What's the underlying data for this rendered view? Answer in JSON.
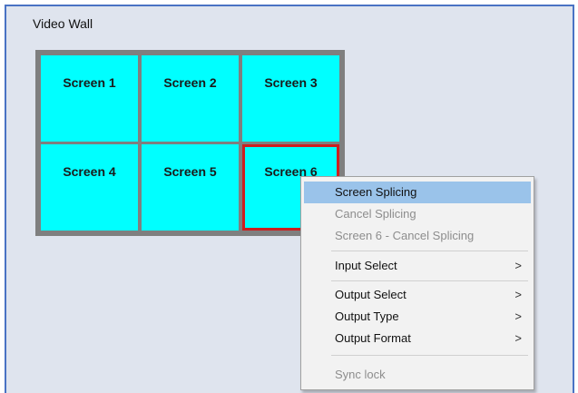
{
  "panel": {
    "title": "Video Wall"
  },
  "screens": [
    {
      "label": "Screen 1",
      "selected": false
    },
    {
      "label": "Screen 2",
      "selected": false
    },
    {
      "label": "Screen 3",
      "selected": false
    },
    {
      "label": "Screen 4",
      "selected": false
    },
    {
      "label": "Screen 5",
      "selected": false
    },
    {
      "label": "Screen 6",
      "selected": true
    }
  ],
  "context_menu": {
    "items": [
      {
        "label": "Screen Splicing",
        "enabled": true,
        "highlighted": true,
        "submenu": false
      },
      {
        "label": "Cancel Splicing",
        "enabled": false,
        "highlighted": false,
        "submenu": false
      },
      {
        "label": "Screen 6 - Cancel Splicing",
        "enabled": false,
        "highlighted": false,
        "submenu": false
      },
      {
        "label": "Input Select",
        "enabled": true,
        "highlighted": false,
        "submenu": true,
        "arrow": ">"
      },
      {
        "label": "Output Select",
        "enabled": true,
        "highlighted": false,
        "submenu": true,
        "arrow": ">"
      },
      {
        "label": "Output Type",
        "enabled": true,
        "highlighted": false,
        "submenu": true,
        "arrow": ">"
      },
      {
        "label": "Output Format",
        "enabled": true,
        "highlighted": false,
        "submenu": true,
        "arrow": ">"
      },
      {
        "label": "Sync lock",
        "enabled": false,
        "highlighted": false,
        "submenu": false
      }
    ]
  },
  "colors": {
    "screen_fill": "#00ffff",
    "wall_bezel": "#7f7f7f",
    "selected_border": "#cc1f1f",
    "menu_highlight": "#9ac3ea",
    "panel_bg": "#dfe4ee",
    "panel_border": "#4a73c4"
  }
}
